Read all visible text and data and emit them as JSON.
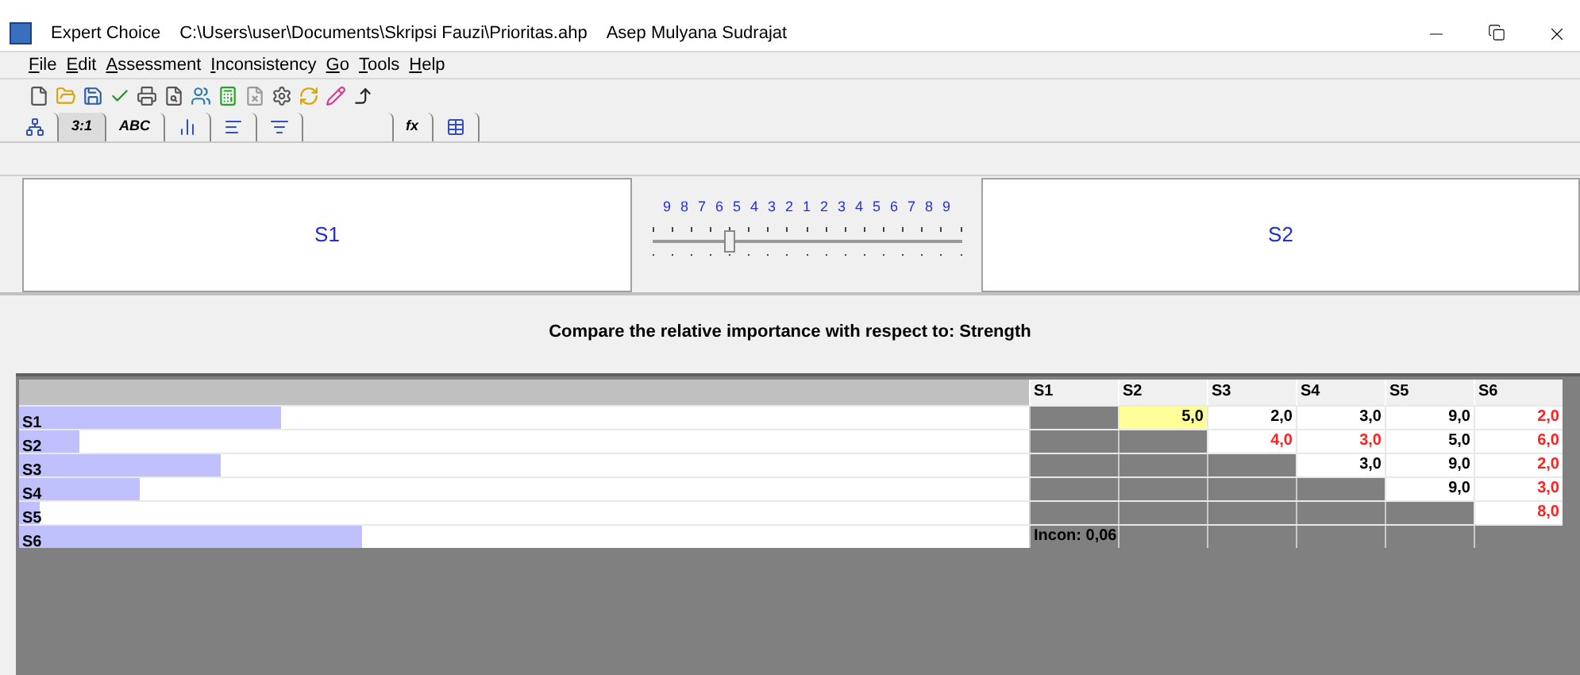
{
  "window": {
    "title": "Expert Choice",
    "path": "C:\\Users\\user\\Documents\\Skripsi Fauzi\\Prioritas.ahp",
    "user": "Asep Mulyana Sudrajat"
  },
  "menu": [
    "File",
    "Edit",
    "Assessment",
    "Inconsistency",
    "Go",
    "Tools",
    "Help"
  ],
  "tabs": [
    {
      "kind": "icon",
      "selected": false
    },
    {
      "kind": "text",
      "label": "3:1",
      "selected": true
    },
    {
      "kind": "text",
      "label": "ABC",
      "selected": false
    },
    {
      "kind": "icon",
      "selected": false
    },
    {
      "kind": "icon",
      "selected": false
    },
    {
      "kind": "icon",
      "selected": false
    },
    {
      "kind": "blank",
      "selected": false
    },
    {
      "kind": "text",
      "label": "fx",
      "selected": false
    },
    {
      "kind": "icon",
      "selected": false
    }
  ],
  "comparison": {
    "left": "S1",
    "right": "S2",
    "scale": [
      "9",
      "8",
      "7",
      "6",
      "5",
      "4",
      "3",
      "2",
      "1",
      "2",
      "3",
      "4",
      "5",
      "6",
      "7",
      "8",
      "9"
    ],
    "level": 0.25
  },
  "prompt": "Compare the relative importance with respect to: Strength",
  "matrix": {
    "columns": [
      "S1",
      "S2",
      "S3",
      "S4",
      "S5",
      "S6"
    ],
    "rows": [
      {
        "label": "S1",
        "level": 0.26,
        "cells": [
          {
            "kind": "empty"
          },
          {
            "kind": "value",
            "text": "5,0",
            "inverse": false,
            "selected": true
          },
          {
            "kind": "value",
            "text": "2,0",
            "inverse": false,
            "selected": false
          },
          {
            "kind": "value",
            "text": "3,0",
            "inverse": false,
            "selected": false
          },
          {
            "kind": "value",
            "text": "9,0",
            "inverse": false,
            "selected": false
          },
          {
            "kind": "value",
            "text": "2,0",
            "inverse": true,
            "selected": false
          }
        ]
      },
      {
        "label": "S2",
        "level": 0.06,
        "cells": [
          {
            "kind": "empty"
          },
          {
            "kind": "empty"
          },
          {
            "kind": "value",
            "text": "4,0",
            "inverse": true,
            "selected": false
          },
          {
            "kind": "value",
            "text": "3,0",
            "inverse": true,
            "selected": false
          },
          {
            "kind": "value",
            "text": "5,0",
            "inverse": false,
            "selected": false
          },
          {
            "kind": "value",
            "text": "6,0",
            "inverse": true,
            "selected": false
          }
        ]
      },
      {
        "label": "S3",
        "level": 0.2,
        "cells": [
          {
            "kind": "empty"
          },
          {
            "kind": "empty"
          },
          {
            "kind": "empty"
          },
          {
            "kind": "value",
            "text": "3,0",
            "inverse": false,
            "selected": false
          },
          {
            "kind": "value",
            "text": "9,0",
            "inverse": false,
            "selected": false
          },
          {
            "kind": "value",
            "text": "2,0",
            "inverse": true,
            "selected": false
          }
        ]
      },
      {
        "label": "S4",
        "level": 0.12,
        "cells": [
          {
            "kind": "empty"
          },
          {
            "kind": "empty"
          },
          {
            "kind": "empty"
          },
          {
            "kind": "empty"
          },
          {
            "kind": "value",
            "text": "9,0",
            "inverse": false,
            "selected": false
          },
          {
            "kind": "value",
            "text": "3,0",
            "inverse": true,
            "selected": false
          }
        ]
      },
      {
        "label": "S5",
        "level": 0.02,
        "cells": [
          {
            "kind": "empty"
          },
          {
            "kind": "empty"
          },
          {
            "kind": "empty"
          },
          {
            "kind": "empty"
          },
          {
            "kind": "empty"
          },
          {
            "kind": "value",
            "text": "8,0",
            "inverse": true,
            "selected": false
          }
        ]
      },
      {
        "label": "S6",
        "level": 0.34,
        "cells": [
          {
            "kind": "note",
            "text": "Incon: 0,06"
          },
          {
            "kind": "empty"
          },
          {
            "kind": "empty"
          },
          {
            "kind": "empty"
          },
          {
            "kind": "empty"
          },
          {
            "kind": "empty"
          }
        ]
      }
    ]
  }
}
